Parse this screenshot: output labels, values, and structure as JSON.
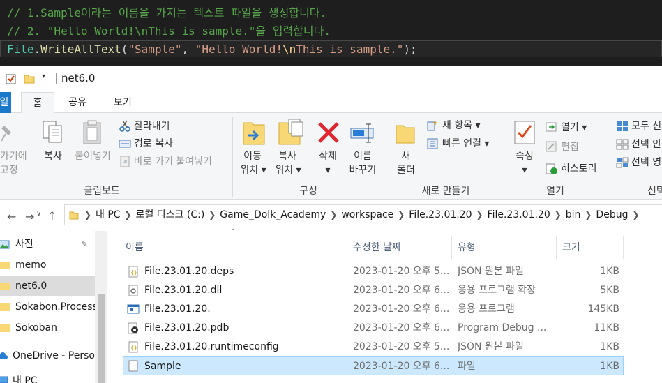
{
  "code": {
    "line1": "// 1.Sample이라는 이름을 가지는 텍스트 파일을 생성합니다.",
    "line2": "// 2. \"Hello World!\\nThis is sample.\"을 입력합니다.",
    "tokens": {
      "cls": "File",
      "dot": ".",
      "method": "WriteAllText",
      "open": "(",
      "arg1": "\"Sample\"",
      "comma": ", ",
      "arg2a": "\"Hello World!",
      "esc": "\\n",
      "arg2b": "This is sample.\"",
      "close": ");"
    }
  },
  "window": {
    "title": "net6.0",
    "qat_dropdown": "▾"
  },
  "ribbon_tabs": {
    "file": "일",
    "home": "홈",
    "share": "공유",
    "view": "보기"
  },
  "ribbon": {
    "clipboard": {
      "pin_line1": "가기에",
      "pin_line2": "고정",
      "copy": "복사",
      "paste": "붙여넣기",
      "cut": "잘라내기",
      "copy_path": "경로 복사",
      "paste_shortcut": "바로 가기 붙여넣기",
      "label": "클립보드"
    },
    "organize": {
      "move_to_1": "이동",
      "move_to_2": "위치 ▾",
      "copy_to_1": "복사",
      "copy_to_2": "위치 ▾",
      "delete_1": "삭제",
      "delete_2": "▾",
      "rename_1": "이름",
      "rename_2": "바꾸기",
      "label": "구성"
    },
    "new": {
      "new_folder_1": "새",
      "new_folder_2": "폴더",
      "new_item": "새 항목 ▾",
      "easy_access": "빠른 연결 ▾",
      "label": "새로 만들기"
    },
    "open": {
      "properties_1": "속성",
      "properties_2": "▾",
      "open": "열기 ▾",
      "edit": "편집",
      "history": "히스토리",
      "label": "열기"
    },
    "select": {
      "select_all": "모두 선",
      "select_none": "선택 안",
      "invert": "선택 영",
      "label": "선택"
    }
  },
  "address": {
    "crumbs": [
      "내 PC",
      "로컬 디스크 (C:)",
      "Game_Dolk_Academy",
      "workspace",
      "File.23.01.20",
      "File.23.01.20",
      "bin",
      "Debug"
    ]
  },
  "nav_pane": {
    "items": [
      {
        "label": "사진"
      },
      {
        "label": "memo"
      },
      {
        "label": "net6.0"
      },
      {
        "label": "Sokabon.Process"
      },
      {
        "label": "Sokoban"
      },
      {
        "label": "OneDrive - Personal"
      },
      {
        "label": "내 PC"
      }
    ]
  },
  "file_list": {
    "columns": {
      "name": "이름",
      "date": "수정한 날짜",
      "type": "유형",
      "size": "크기"
    },
    "rows": [
      {
        "name": "File.23.01.20.deps",
        "date": "2023-01-20 오후 5...",
        "type": "JSON 원본 파일",
        "size": "1KB"
      },
      {
        "name": "File.23.01.20.dll",
        "date": "2023-01-20 오후 6...",
        "type": "응용 프로그램 확장",
        "size": "5KB"
      },
      {
        "name": "File.23.01.20.",
        "date": "2023-01-20 오후 6...",
        "type": "응용 프로그램",
        "size": "145KB"
      },
      {
        "name": "File.23.01.20.pdb",
        "date": "2023-01-20 오후 6...",
        "type": "Program Debug ...",
        "size": "11KB"
      },
      {
        "name": "File.23.01.20.runtimeconfig",
        "date": "2023-01-20 오후 5...",
        "type": "JSON 원본 파일",
        "size": "1KB"
      },
      {
        "name": "Sample",
        "date": "2023-01-20 오후 6...",
        "type": "파일",
        "size": "1KB"
      }
    ]
  },
  "colors": {
    "selection": "#cce8ff",
    "ribbon_bg": "#f5f6f7",
    "code_bg": "#1e1e1e",
    "folder": "#f8d775"
  }
}
